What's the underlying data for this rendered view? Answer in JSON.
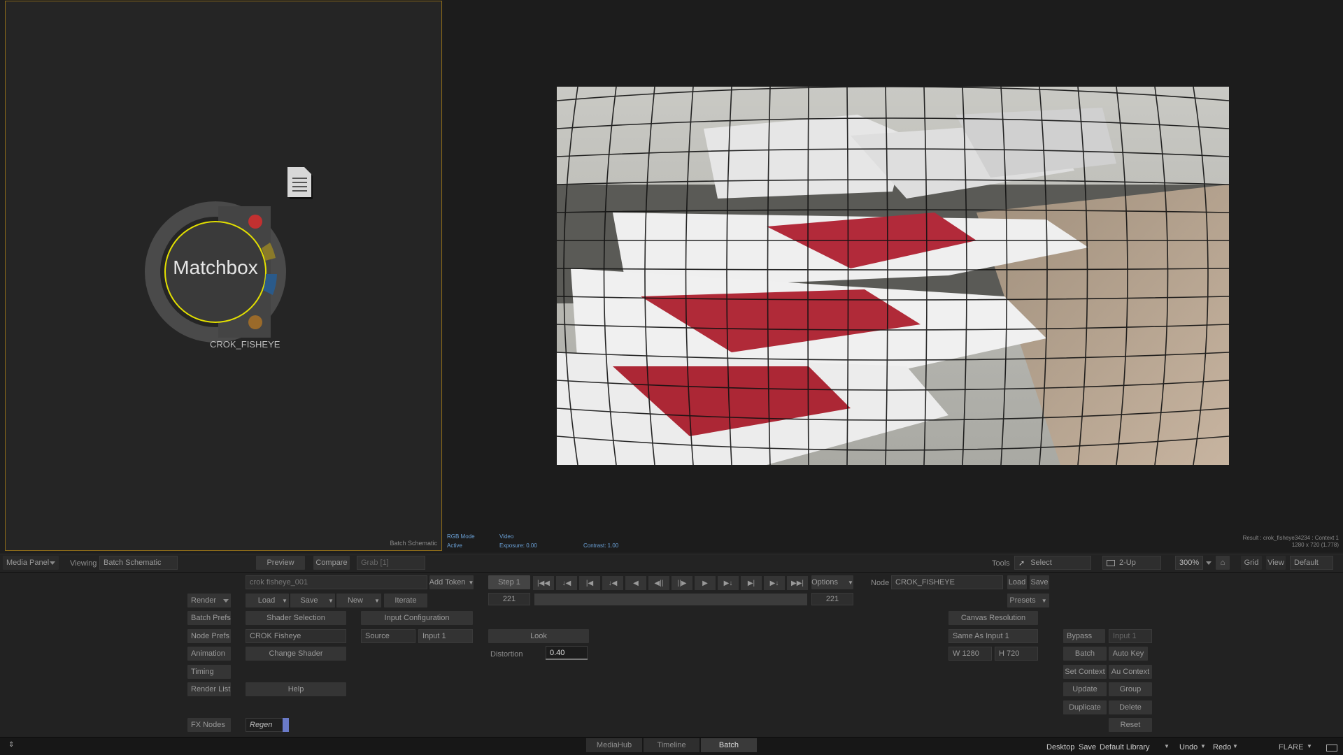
{
  "schematic": {
    "node_title": "Matchbox",
    "node_label": "CROK_FISHEYE",
    "footer_label": "Batch Schematic"
  },
  "viewer": {
    "rgb_mode_label": "RGB Mode",
    "rgb_mode_value": "Active",
    "video_label": "Video",
    "exposure": "Exposure: 0.00",
    "contrast": "Contrast: 1.00",
    "result_line1": "Result : crok_fisheye34234 : Context 1",
    "result_line2": "1280 x 720 (1.778)"
  },
  "toolbar": {
    "media_panel": "Media Panel",
    "viewing_label": "Viewing",
    "viewing_value": "Batch Schematic",
    "preview": "Preview",
    "compare": "Compare",
    "grab": "Grab [1]",
    "tools_label": "Tools",
    "select": "Select",
    "two_up": "2-Up",
    "zoom": "300%",
    "grid": "Grid",
    "view": "View",
    "default": "Default"
  },
  "panel": {
    "left_buttons": [
      "Render",
      "Batch Prefs",
      "Node Prefs",
      "Animation",
      "Timing",
      "Render List",
      "FX Nodes"
    ],
    "filename": "crok fisheye_001",
    "add_token": "Add Token",
    "load": "Load",
    "save": "Save",
    "new": "New",
    "iterate": "Iterate",
    "shader_selection": "Shader Selection",
    "shader_name": "CROK Fisheye",
    "change_shader": "Change Shader",
    "help": "Help",
    "regen": "Regen",
    "input_configuration": "Input Configuration",
    "source_label": "Source",
    "source_value": "Input 1",
    "step": "Step 1",
    "frame_start": "221",
    "frame_end": "221",
    "options": "Options",
    "look": "Look",
    "distortion_label": "Distortion",
    "distortion_value": "0.40",
    "node_label": "Node",
    "node_value": "CROK_FISHEYE",
    "node_load": "Load",
    "node_save": "Save",
    "presets": "Presets",
    "canvas_resolution": "Canvas Resolution",
    "same_as_input": "Same As Input 1",
    "width": "W 1280",
    "height": "H 720",
    "bypass": "Bypass",
    "bypass_input": "Input 1",
    "batch": "Batch",
    "auto_key": "Auto Key",
    "set_context": "Set Context",
    "au_context": "Au Context",
    "update": "Update",
    "group": "Group",
    "duplicate": "Duplicate",
    "delete": "Delete",
    "reset": "Reset"
  },
  "bottom": {
    "tabs": [
      "MediaHub",
      "Timeline",
      "Batch"
    ],
    "desktop": "Desktop",
    "save": "Save",
    "library": "Default Library",
    "undo": "Undo",
    "redo": "Redo",
    "app": "FLARE"
  }
}
